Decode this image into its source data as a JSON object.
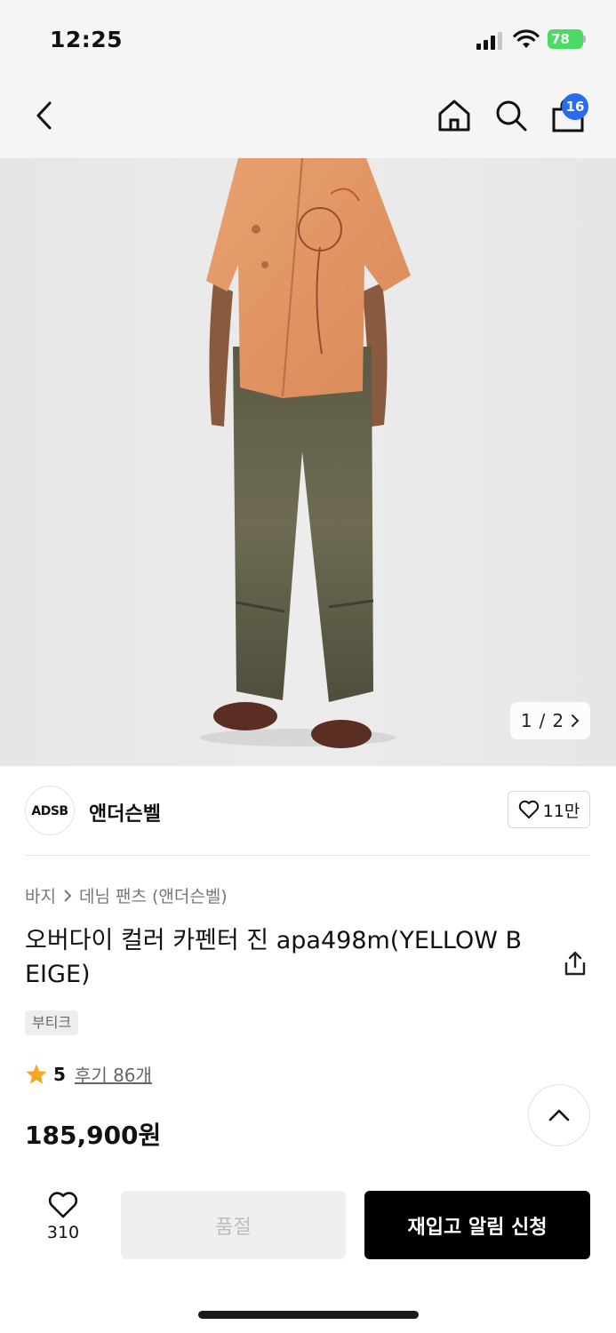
{
  "status_bar": {
    "time": "12:25",
    "battery": "78"
  },
  "header": {
    "cart_count": "16"
  },
  "product_image": {
    "counter_current": "1",
    "counter_sep": "/",
    "counter_total": "2"
  },
  "brand": {
    "logo": "ADSB",
    "name": "앤더슨벨",
    "likes": "11만"
  },
  "product": {
    "breadcrumb": [
      "바지",
      "데님 팬츠 (앤더슨벨)"
    ],
    "title": "오버다이 컬러 카펜터 진 apa498m(YELLOW BEIGE)",
    "tag": "부티크",
    "rating": "5",
    "reviews": "후기 86개",
    "price": "185,900원"
  },
  "bottom_bar": {
    "wish_count": "310",
    "soldout_label": "품절",
    "restock_label": "재입고 알림 신청"
  },
  "colors": {
    "accent_badge": "#2a6cf0",
    "star": "#f5a623",
    "primary_button": "#000000",
    "battery": "#4cd964"
  }
}
